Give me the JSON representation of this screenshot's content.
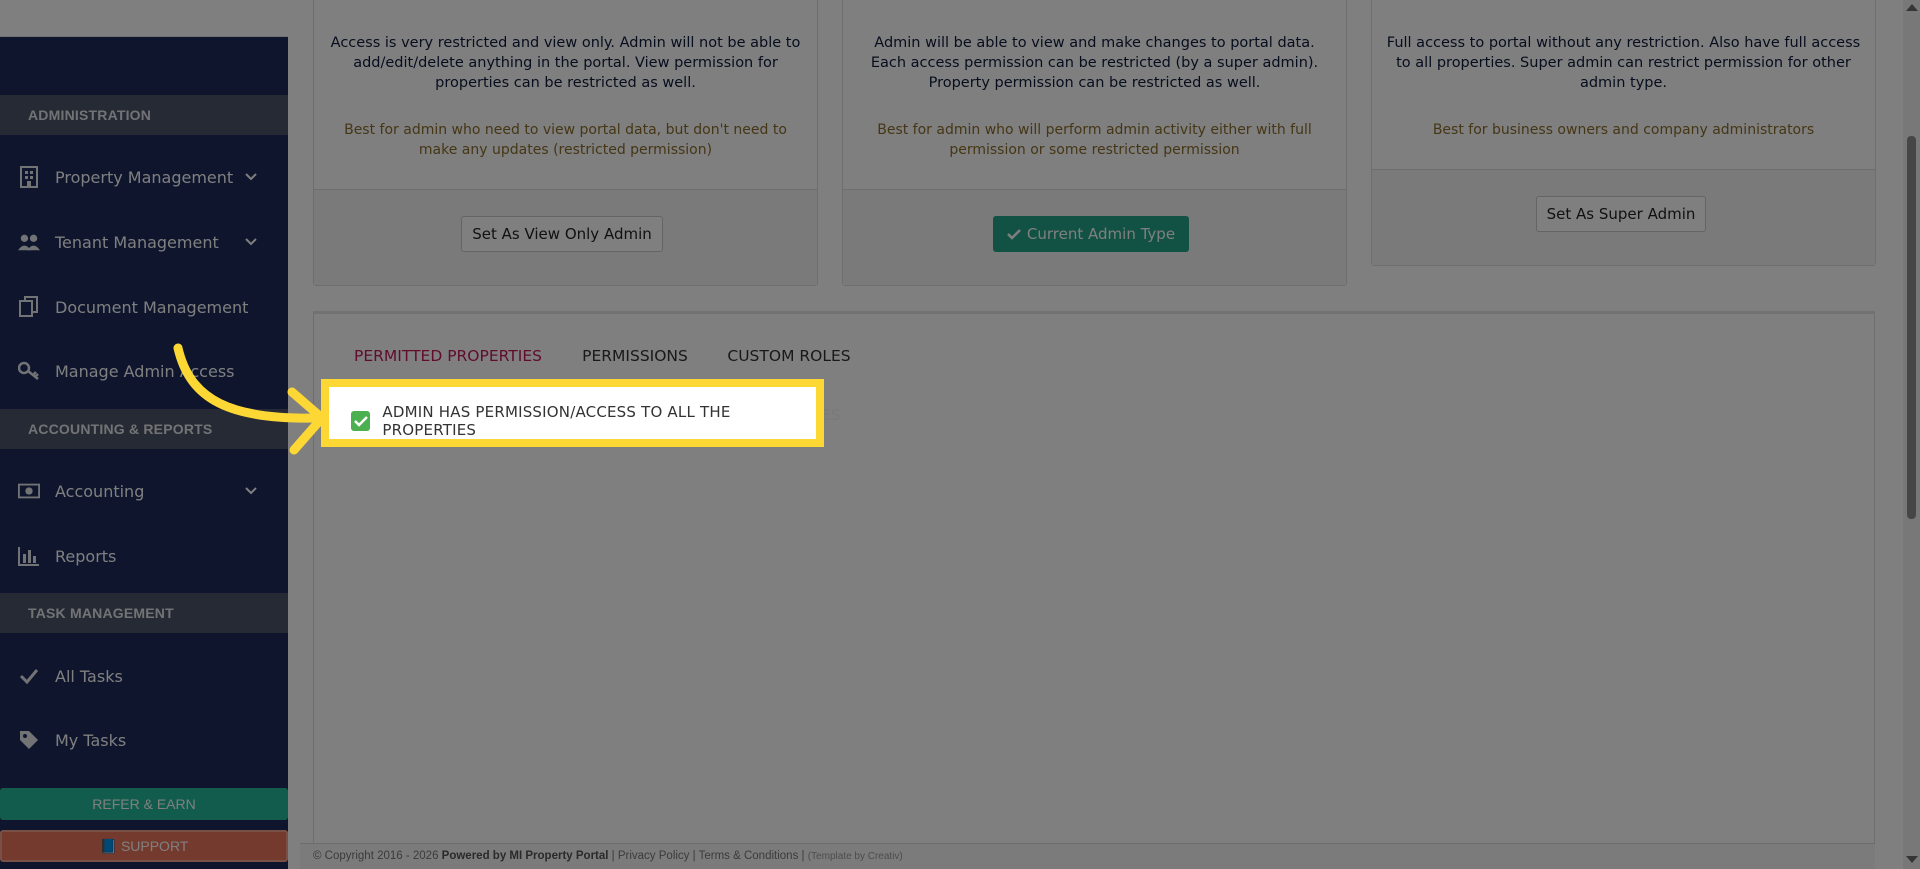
{
  "sidebar": {
    "sections": {
      "administration": "ADMINISTRATION",
      "accounting": "ACCOUNTING & REPORTS",
      "tasks": "TASK MANAGEMENT"
    },
    "items": {
      "property": "Property Management",
      "tenant": "Tenant Management",
      "document": "Document Management",
      "admin_access": "Manage Admin Access",
      "accounting": "Accounting",
      "reports": "Reports",
      "all_tasks": "All Tasks",
      "my_tasks": "My Tasks"
    },
    "refer_label": "REFER & EARN",
    "support_label": "SUPPORT"
  },
  "cards": {
    "view_only": {
      "description": "Access is very restricted and view only. Admin will not be able to add/edit/delete anything in the portal. View permission for properties can be restricted as well.",
      "best_for": "Best for admin who need to view portal data, but don't need to make any updates (restricted permission)",
      "button": "Set As View Only Admin"
    },
    "admin": {
      "description": "Admin will be able to view and make changes to portal data. Each access permission can be restricted (by a super admin). Property permission can be restricted as well.",
      "best_for": "Best for admin who will perform admin activity either with full permission or some restricted permission",
      "button": "Current Admin Type"
    },
    "super_admin": {
      "description": "Full access to portal without any restriction. Also have full access to all properties. Super admin can restrict permission for other admin type.",
      "best_for": "Best for business owners and company administrators",
      "button": "Set As Super Admin"
    }
  },
  "tabs": {
    "permitted": "PERMITTED PROPERTIES",
    "permissions": "PERMISSIONS",
    "custom_roles": "CUSTOM ROLES"
  },
  "checkbox_label": "ADMIN HAS PERMISSION/ACCESS TO ALL THE PROPERTIES",
  "checkbox_overflow": "IES",
  "footer": {
    "copyright": "© Copyright 2016 - 2026",
    "powered": "Powered by MI Property Portal",
    "privacy": "Privacy Policy",
    "terms": "Terms & Conditions",
    "template": "(Template by Creativ)"
  },
  "colors": {
    "sidebar_bg": "#1c2a5a",
    "accent_green": "#24a488",
    "tab_active": "#c2185b",
    "highlight": "#fdd835"
  }
}
